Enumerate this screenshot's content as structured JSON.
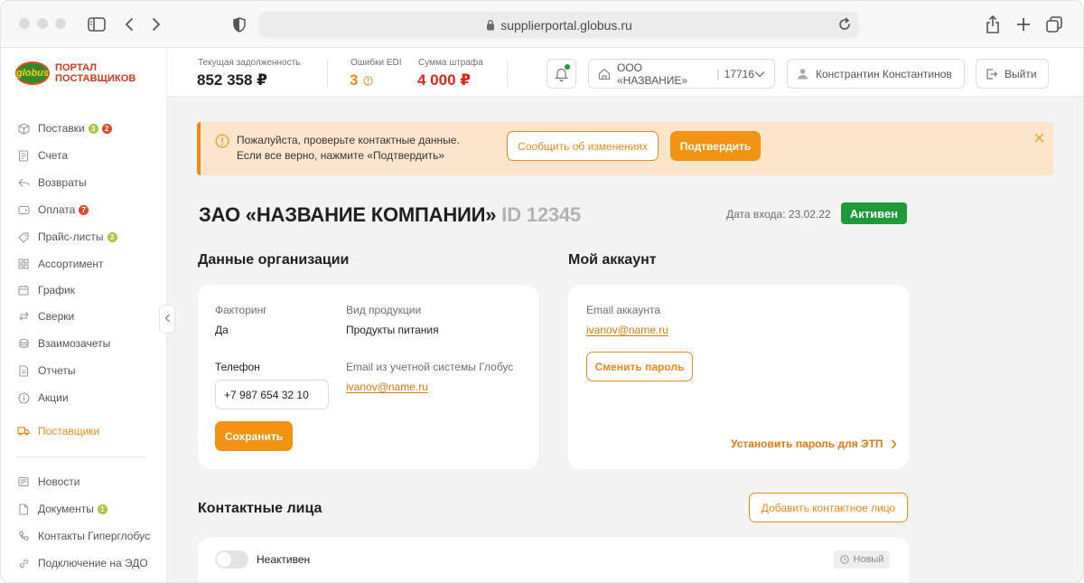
{
  "browser": {
    "url": "supplierportal.globus.ru"
  },
  "sidebar": {
    "logo_mark": "globus",
    "logo_line1": "ПОРТАЛ",
    "logo_line2": "ПОСТАВЩИКОВ",
    "items": [
      {
        "label": "Поставки",
        "icon": "box-icon",
        "badges": [
          {
            "value": "3",
            "color": "green"
          },
          {
            "value": "2",
            "color": "red"
          }
        ]
      },
      {
        "label": "Счета",
        "icon": "invoice-icon",
        "badges": []
      },
      {
        "label": "Возвраты",
        "icon": "return-icon",
        "badges": []
      },
      {
        "label": "Оплата",
        "icon": "wallet-icon",
        "badges": [
          {
            "value": "7",
            "color": "red"
          }
        ]
      },
      {
        "label": "Прайс-листы",
        "icon": "tag-icon",
        "badges": [
          {
            "value": "3",
            "color": "green"
          }
        ]
      },
      {
        "label": "Ассортимент",
        "icon": "grid-icon",
        "badges": []
      },
      {
        "label": "График",
        "icon": "calendar-icon",
        "badges": []
      },
      {
        "label": "Сверки",
        "icon": "arrows-icon",
        "badges": []
      },
      {
        "label": "Взаимозачеты",
        "icon": "coins-icon",
        "badges": []
      },
      {
        "label": "Отчеты",
        "icon": "report-icon",
        "badges": []
      },
      {
        "label": "Акции",
        "icon": "info-icon",
        "badges": []
      },
      {
        "label": "Поставщики",
        "icon": "truck-icon",
        "badges": [],
        "active": true
      },
      {
        "label": "Новости",
        "icon": "news-icon",
        "badges": []
      },
      {
        "label": "Документы",
        "icon": "document-icon",
        "badges": [
          {
            "value": "1",
            "color": "green"
          }
        ]
      },
      {
        "label": "Контакты Гиперглобус",
        "icon": "phone-icon",
        "badges": []
      },
      {
        "label": "Подключение на ЭДО",
        "icon": "link-icon",
        "badges": []
      }
    ]
  },
  "topbar": {
    "debt_label": "Текущая задолженность",
    "debt_value": "852 358 ₽",
    "edi_label": "Ошибки EDI",
    "edi_value": "3",
    "fine_label": "Сумма штрафа",
    "fine_value": "4 000 ₽",
    "org_name": "ООО «НАЗВАНИЕ»",
    "org_code": "17716",
    "user_name": "Констрантин Константинов",
    "logout_label": "Выйти"
  },
  "alert": {
    "line1": "Пожалуйста, проверьте контактные данные.",
    "line2": "Если все верно, нажмите «Подтвердить»",
    "report_label": "Сообщить об изменениях",
    "confirm_label": "Подтвердить"
  },
  "company": {
    "name": "ЗАО «НАЗВАНИЕ КОМПАНИИ»",
    "id": "ID 12345",
    "login_date": "Дата входа: 23.02.22",
    "status": "Активен"
  },
  "org_data": {
    "title": "Данные организации",
    "factoring_label": "Факторинг",
    "factoring_value": "Да",
    "product_label": "Вид продукции",
    "product_value": "Продукты питания",
    "phone_label": "Телефон",
    "phone_value": "+7 987 654 32 10",
    "email_label": "Email из учетной системы Глобус",
    "email_value": "ivanov@name.ru",
    "save_label": "Сохранить"
  },
  "account": {
    "title": "Мой аккаунт",
    "email_label": "Email аккаунта",
    "email_value": "ivanov@name.ru",
    "change_password_label": "Сменить пароль",
    "etp_link_label": "Установить пароль  для ЭТП"
  },
  "contacts": {
    "title": "Контактные лица",
    "add_label": "Добавить контактное лицо",
    "toggle_label": "Неактивен",
    "new_tag": "Новый"
  },
  "colors": {
    "accent": "#f39313",
    "accent_dark": "#e07a0a",
    "success": "#1f9a3a",
    "alert_bg": "#fde5cc",
    "fine": "#e0261c"
  }
}
